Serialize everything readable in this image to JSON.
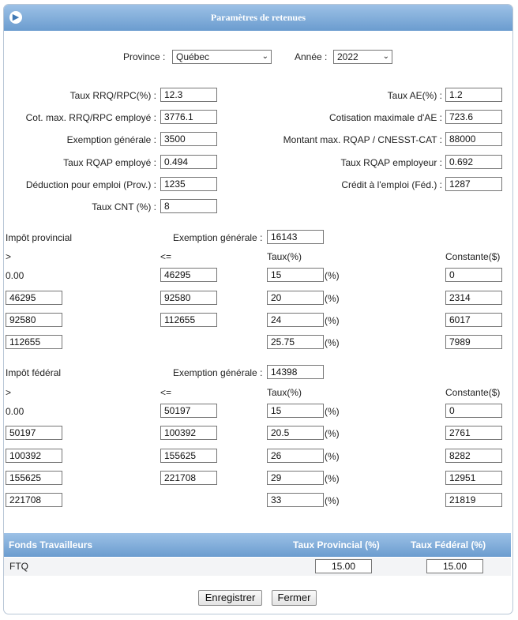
{
  "window": {
    "title": "Paramètres de retenues"
  },
  "top": {
    "province_label": "Province :",
    "province_value": "Québec",
    "year_label": "Année :",
    "year_value": "2022"
  },
  "params_left": [
    {
      "label": "Taux RRQ/RPC(%) :",
      "value": "12.3"
    },
    {
      "label": "Cot. max. RRQ/RPC employé :",
      "value": "3776.1"
    },
    {
      "label": "Exemption générale :",
      "value": "3500"
    },
    {
      "label": "Taux RQAP employé :",
      "value": "0.494"
    },
    {
      "label": "Déduction pour emploi (Prov.) :",
      "value": "1235"
    },
    {
      "label": "Taux CNT (%) :",
      "value": "8"
    }
  ],
  "params_right": [
    {
      "label": "Taux AE(%) :",
      "value": "1.2"
    },
    {
      "label": "Cotisation maximale d'AE :",
      "value": "723.6"
    },
    {
      "label": "Montant max. RQAP / CNESST-CAT :",
      "value": "88000"
    },
    {
      "label": "Taux RQAP employeur :",
      "value": "0.692"
    },
    {
      "label": "Crédit à l'emploi (Féd.) :",
      "value": "1287"
    }
  ],
  "prov": {
    "title": "Impôt provincial",
    "exemption_label": "Exemption générale :",
    "exemption_value": "16143",
    "col_gt": ">",
    "col_le": "<=",
    "col_rate": "Taux(%)",
    "col_const": "Constante($)",
    "pct_suffix": "(%)",
    "rows": [
      {
        "gt": "0.00",
        "le": "46295",
        "rate": "15",
        "const": "0"
      },
      {
        "gt": "46295",
        "le": "92580",
        "rate": "20",
        "const": "2314"
      },
      {
        "gt": "92580",
        "le": "112655",
        "rate": "24",
        "const": "6017"
      },
      {
        "gt": "112655",
        "le": "",
        "rate": "25.75",
        "const": "7989"
      }
    ]
  },
  "fed": {
    "title": "Impôt fédéral",
    "exemption_label": "Exemption générale :",
    "exemption_value": "14398",
    "col_gt": ">",
    "col_le": "<=",
    "col_rate": "Taux(%)",
    "col_const": "Constante($)",
    "pct_suffix": "(%)",
    "rows": [
      {
        "gt": "0.00",
        "le": "50197",
        "rate": "15",
        "const": "0"
      },
      {
        "gt": "50197",
        "le": "100392",
        "rate": "20.5",
        "const": "2761"
      },
      {
        "gt": "100392",
        "le": "155625",
        "rate": "26",
        "const": "8282"
      },
      {
        "gt": "155625",
        "le": "221708",
        "rate": "29",
        "const": "12951"
      },
      {
        "gt": "221708",
        "le": "",
        "rate": "33",
        "const": "21819"
      }
    ]
  },
  "funds": {
    "header_name": "Fonds Travailleurs",
    "header_prov": "Taux Provincial (%)",
    "header_fed": "Taux Fédéral (%)",
    "rows": [
      {
        "name": "FTQ",
        "prov": "15.00",
        "fed": "15.00"
      }
    ]
  },
  "buttons": {
    "save": "Enregistrer",
    "close": "Fermer"
  },
  "colors": {
    "header_top": "#9cc1e6",
    "header_bottom": "#6b9ccf"
  }
}
